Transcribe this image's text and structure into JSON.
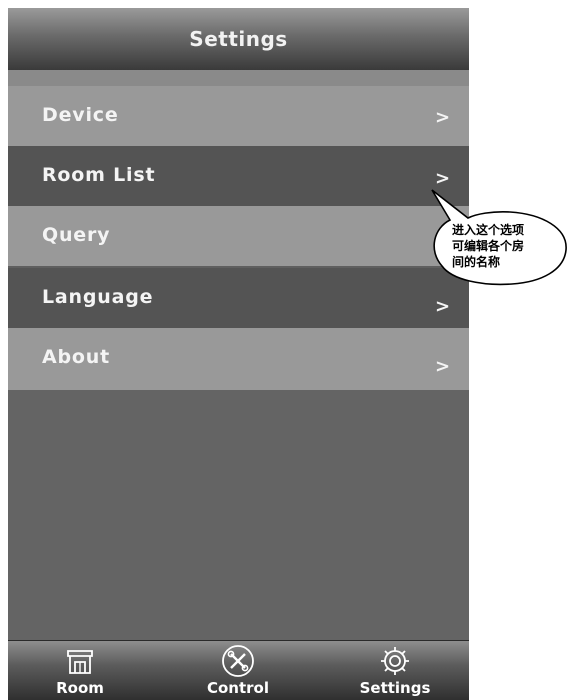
{
  "header": {
    "title": "Settings"
  },
  "menu": [
    {
      "label": "Device",
      "chevron": ">"
    },
    {
      "label": "Room List",
      "chevron": ">"
    },
    {
      "label": "Query",
      "chevron": ">"
    },
    {
      "label": "Language",
      "chevron": ">"
    },
    {
      "label": "About",
      "chevron": ">"
    }
  ],
  "callout": {
    "lines": [
      "进入这个选项",
      "可编辑各个房",
      "间的名称"
    ]
  },
  "tabbar": {
    "items": [
      {
        "label": "Room",
        "icon": "store-icon"
      },
      {
        "label": "Control",
        "icon": "tools-icon"
      },
      {
        "label": "Settings",
        "icon": "gear-icon"
      }
    ],
    "active": "Settings"
  },
  "colors": {
    "light_row": "#999999",
    "dark_row": "#545454",
    "background": "#5f5f5f"
  }
}
